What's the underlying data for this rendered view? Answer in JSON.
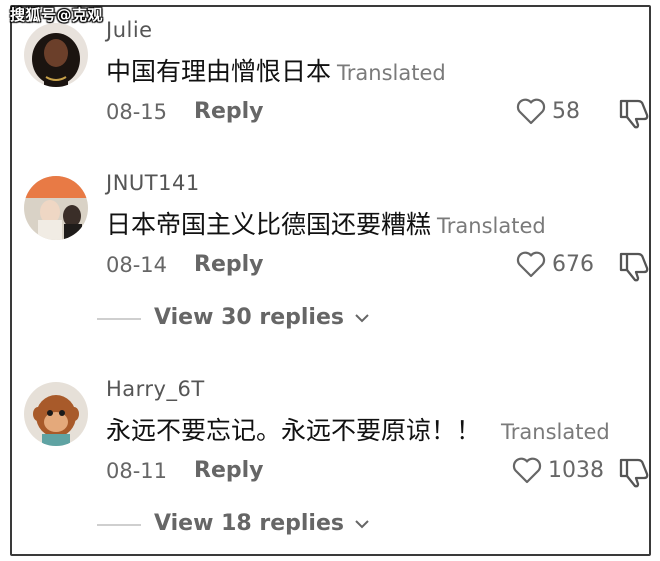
{
  "watermark": "搜狐号@克观",
  "comments": [
    {
      "username": "Julie",
      "text": "中国有理由憎恨日本",
      "translated_label": "Translated",
      "date": "08-15",
      "reply_label": "Reply",
      "likes": "58"
    },
    {
      "username": "JNUT141",
      "text": "日本帝国主义比德国还要糟糕",
      "translated_label": "Translated",
      "date": "08-14",
      "reply_label": "Reply",
      "likes": "676",
      "view_replies": "View 30 replies"
    },
    {
      "username": "Harry_6T",
      "text": "永远不要忘记。永远不要原谅！！",
      "translated_label": "Translated",
      "date": "08-11",
      "reply_label": "Reply",
      "likes": "1038",
      "view_replies": "View 18 replies"
    }
  ],
  "colors": {
    "text": "#111111",
    "secondary": "#666666",
    "translated": "#7a7a7a"
  }
}
